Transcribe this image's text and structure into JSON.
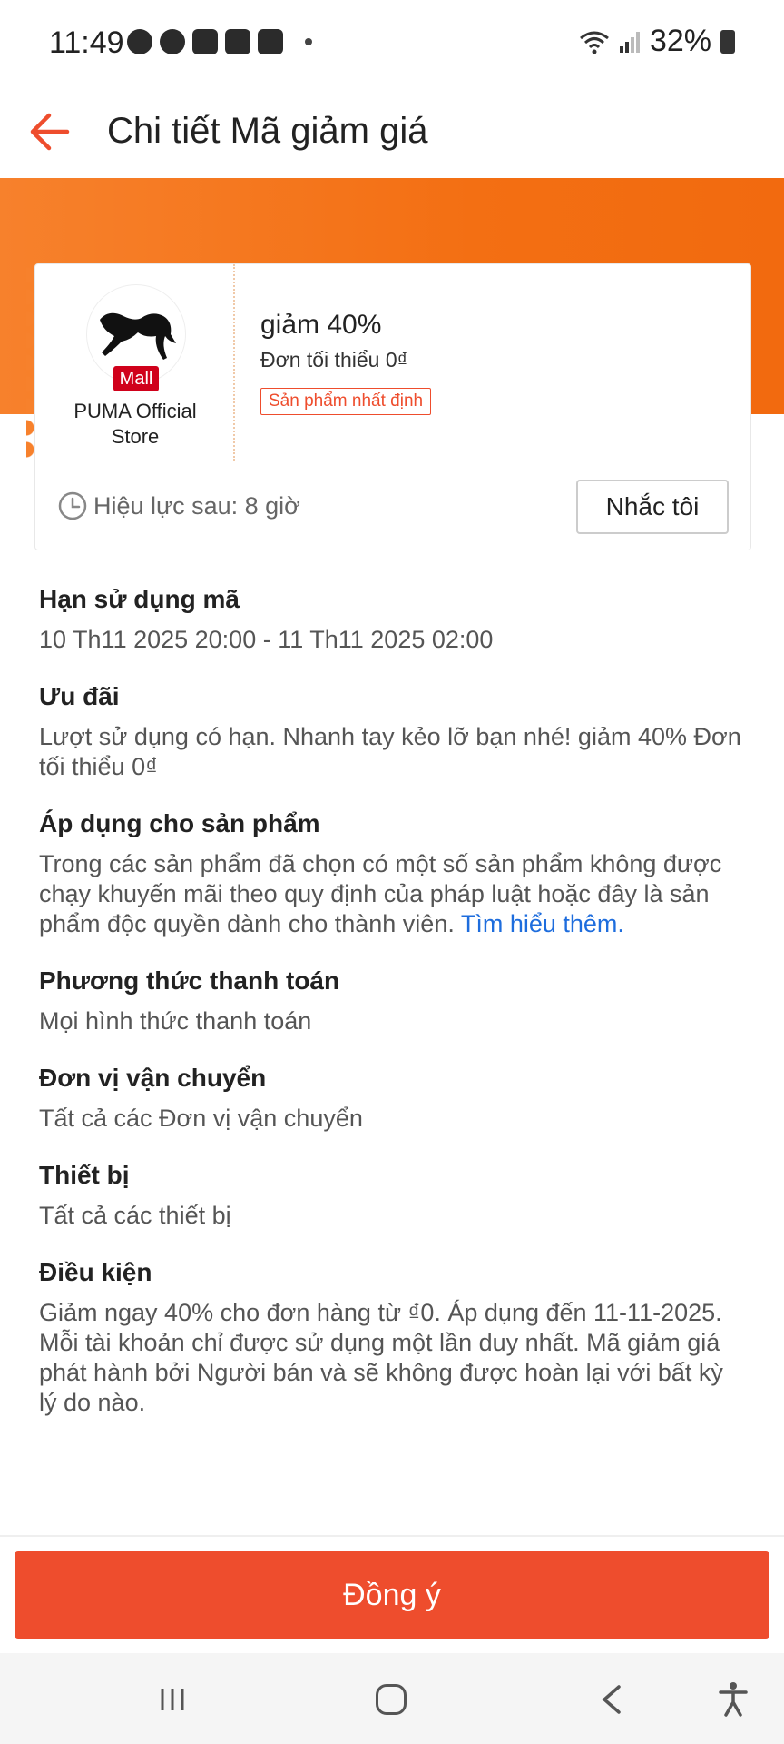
{
  "status_bar": {
    "time": "11:49",
    "battery": "32%",
    "notification_icons": [
      "messenger-icon",
      "messenger-icon",
      "shopee-icon",
      "h-app-icon",
      "h-app-icon"
    ]
  },
  "header": {
    "back_icon": "arrow-left-icon",
    "title": "Chi tiết Mã giảm giá"
  },
  "voucher": {
    "store_name": "PUMA Official Store",
    "badge": "Mall",
    "discount": "giảm 40%",
    "min_order": "Đơn tối thiểu 0₫",
    "tag": "Sản phẩm nhất định",
    "validity": "Hiệu lực sau: 8 giờ",
    "remind_label": "Nhắc tôi"
  },
  "sections": {
    "expiry": {
      "title": "Hạn sử dụng mã",
      "body": "10 Th11 2025 20:00 - 11 Th11 2025 02:00"
    },
    "offer": {
      "title": "Ưu đãi",
      "body": "Lượt sử dụng có hạn. Nhanh tay kẻo lỡ bạn nhé! giảm 40% Đơn tối thiểu 0₫"
    },
    "products": {
      "title": "Áp dụng cho sản phẩm",
      "body": "Trong các sản phẩm đã chọn có một số sản phẩm không được chạy khuyến mãi theo quy định của pháp luật hoặc đây là sản phẩm độc quyền dành cho thành viên. ",
      "link": "Tìm hiểu thêm."
    },
    "payment": {
      "title": "Phương thức thanh toán",
      "body": "Mọi hình thức thanh toán"
    },
    "shipping": {
      "title": "Đơn vị vận chuyển",
      "body": "Tất cả các Đơn vị vận chuyển"
    },
    "device": {
      "title": "Thiết bị",
      "body": "Tất cả các thiết bị"
    },
    "conditions": {
      "title": "Điều kiện",
      "body": "Giảm ngay 40% cho đơn hàng từ ₫0. Áp dụng đến 11-11-2025. Mỗi tài khoản chỉ được sử dụng một lần duy nhất. Mã giảm giá phát hành bởi Người bán và sẽ không được hoàn lại với bất kỳ lý do nào."
    }
  },
  "footer": {
    "agree_label": "Đồng ý"
  },
  "colors": {
    "accent": "#ee4d2d",
    "orange_band": "#f36f13",
    "link": "#1e6ddd",
    "mall_red": "#d0011b"
  }
}
